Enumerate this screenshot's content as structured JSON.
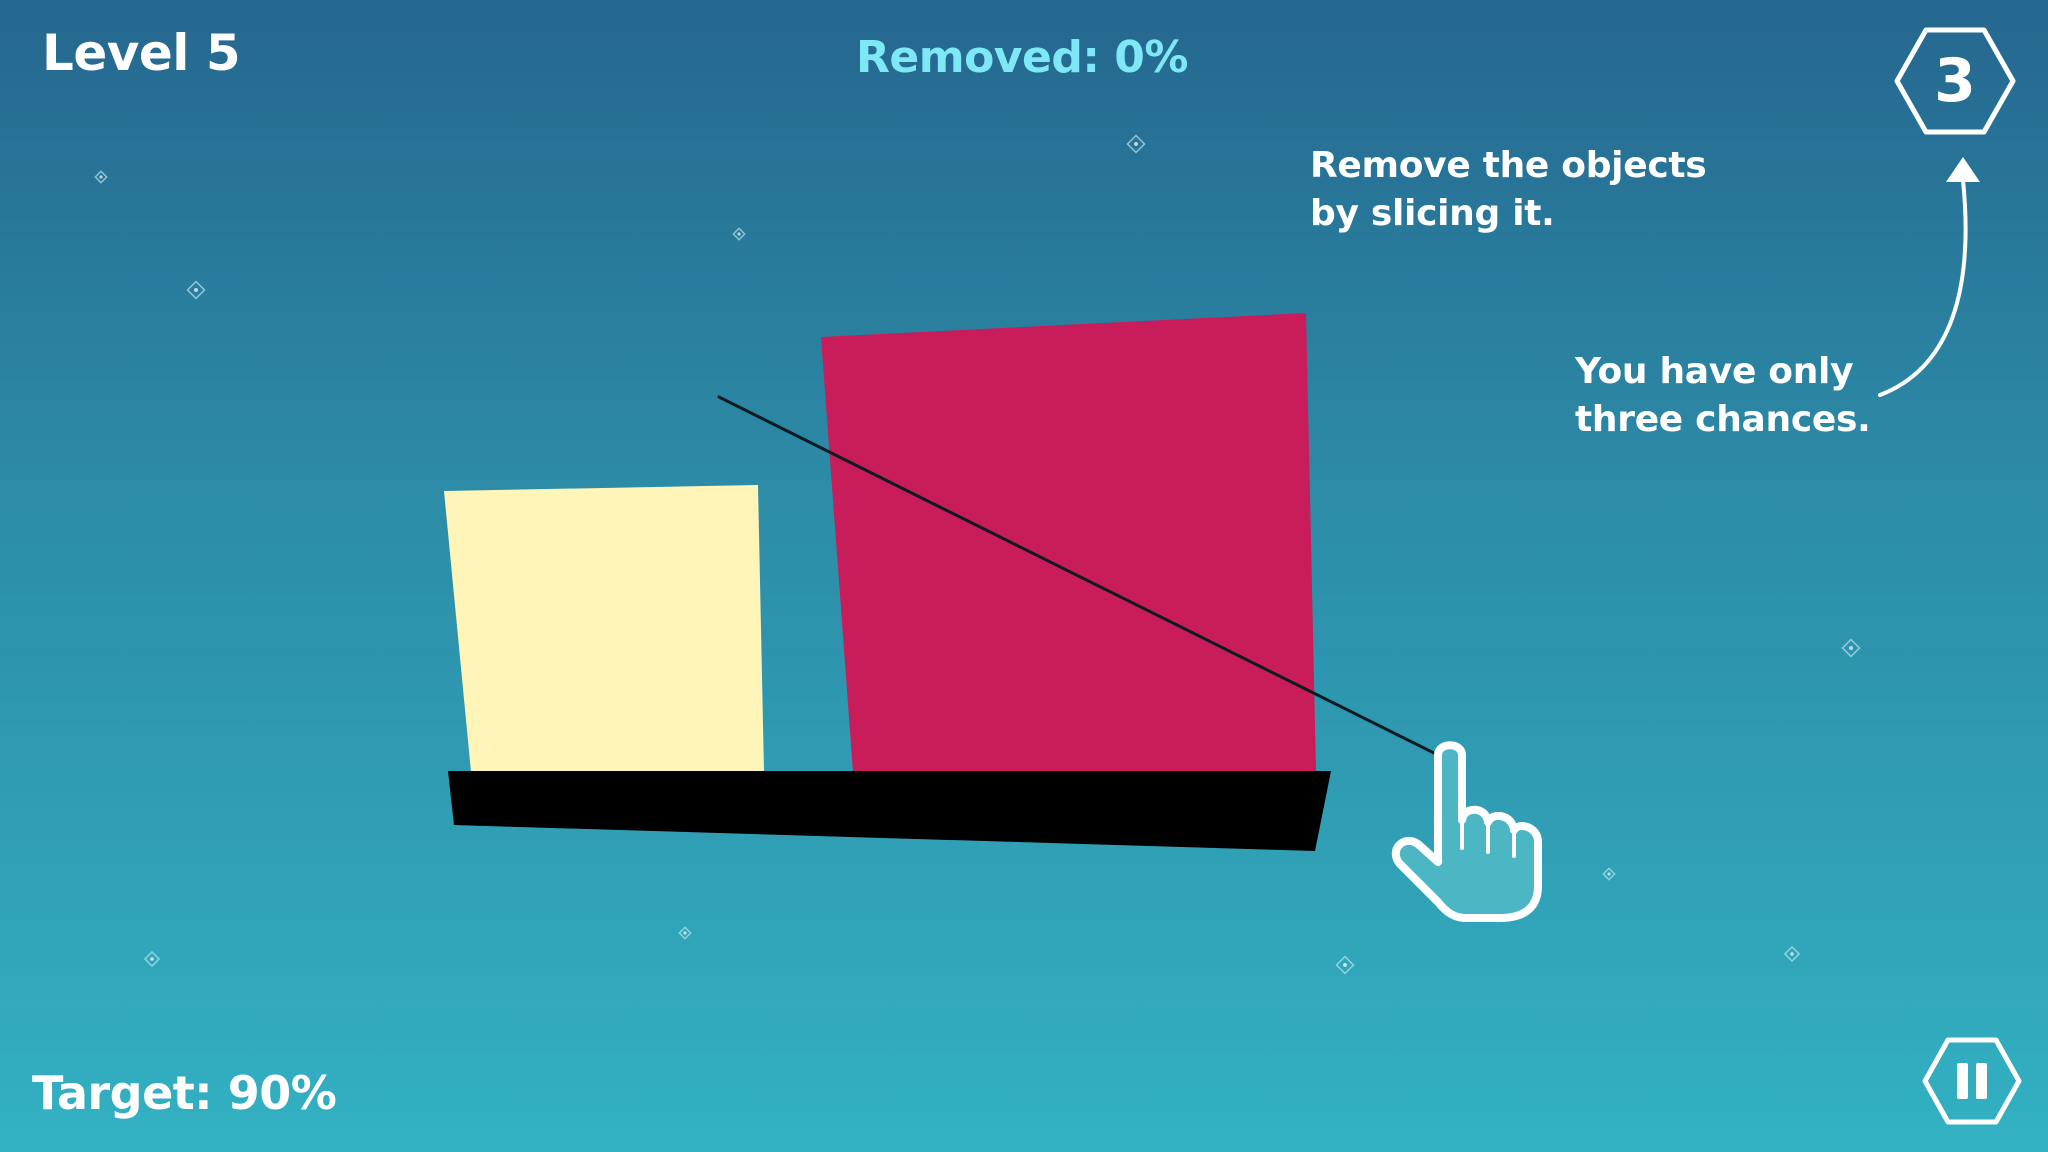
{
  "hud": {
    "level": "Level 5",
    "removed": "Removed: 0%",
    "target": "Target: 90%",
    "chances": "3"
  },
  "tutorial": {
    "slice_hint": [
      "Remove the objects",
      "by slicing it."
    ],
    "chances_hint": [
      "You have only",
      "three chances."
    ]
  },
  "icons": {
    "chances_badge": "hexagon-icon",
    "pause": "pause-icon",
    "hand": "pointing-hand-icon",
    "arrow": "curved-arrow-icon"
  },
  "objects": [
    {
      "name": "cream-block",
      "color": "#fff5b8"
    },
    {
      "name": "crimson-block",
      "color": "#c91c5b"
    },
    {
      "name": "platform",
      "color": "#000000"
    }
  ],
  "colors": {
    "background_top": "#25678f",
    "background_bottom": "#33b1c3",
    "removed_text": "#7fe8f7",
    "hand_fill": "#4db6c4"
  }
}
